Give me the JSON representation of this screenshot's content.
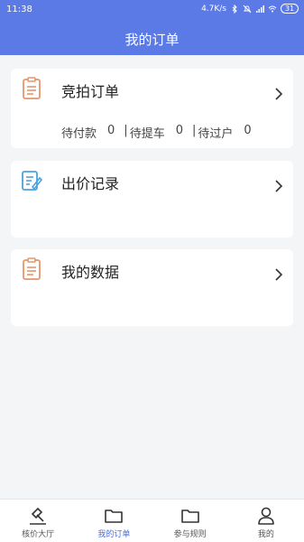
{
  "status_bar": {
    "time": "11:38",
    "speed": "4.7K/s",
    "battery": "31"
  },
  "header": {
    "title": "我的订单"
  },
  "cards": [
    {
      "title": "竞拍订单",
      "icon": "clipboard-icon",
      "statuses": [
        {
          "label": "待付款",
          "count": "0"
        },
        {
          "label": "待提车",
          "count": "0"
        },
        {
          "label": "待过户",
          "count": "0"
        }
      ]
    },
    {
      "title": "出价记录",
      "icon": "edit-note-icon"
    },
    {
      "title": "我的数据",
      "icon": "clipboard-icon"
    }
  ],
  "tabbar": {
    "items": [
      {
        "label": "核价大厅",
        "icon": "auction-hammer-icon"
      },
      {
        "label": "我的订单",
        "icon": "folder-icon",
        "active": true
      },
      {
        "label": "参与规则",
        "icon": "folder-icon"
      },
      {
        "label": "我的",
        "icon": "user-icon"
      }
    ]
  },
  "colors": {
    "header": "#5b7ae6",
    "accent": "#4a6fe0",
    "icon_orange": "#e8956b",
    "icon_blue": "#4aa3df"
  }
}
